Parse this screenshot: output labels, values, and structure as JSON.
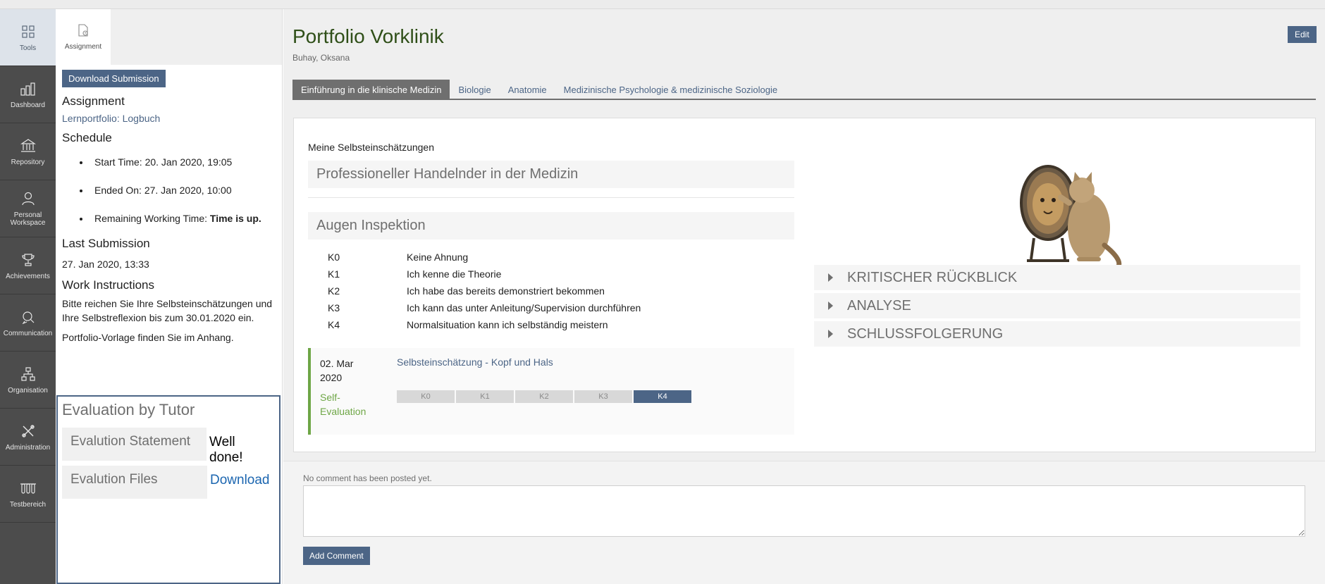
{
  "mainbar": {
    "items": [
      {
        "label": "Tools",
        "icon": "tools-icon"
      },
      {
        "label": "Dashboard",
        "icon": "dashboard-icon"
      },
      {
        "label": "Repository",
        "icon": "repository-icon"
      },
      {
        "label": "Personal Workspace",
        "icon": "person-icon"
      },
      {
        "label": "Achievements",
        "icon": "trophy-icon"
      },
      {
        "label": "Communication",
        "icon": "chat-icon"
      },
      {
        "label": "Organisation",
        "icon": "org-chart-icon"
      },
      {
        "label": "Administration",
        "icon": "wrench-icon"
      },
      {
        "label": "Testbereich",
        "icon": "test-tubes-icon"
      }
    ]
  },
  "slate": {
    "tab_label": "Assignment",
    "download_label": "Download Submission",
    "assignment_heading": "Assignment",
    "assignment_link": "Lernportfolio: Logbuch",
    "schedule_heading": "Schedule",
    "start_time": "Start Time: 20. Jan 2020, 19:05",
    "ended_on": "Ended On: 27. Jan 2020, 10:00",
    "remaining_prefix": "Remaining Working Time: ",
    "remaining_value": "Time is up.",
    "last_submission_heading": "Last Submission",
    "last_submission_value": "27. Jan 2020, 13:33",
    "instructions_heading": "Work Instructions",
    "instructions_text": "Bitte reichen Sie Ihre Selbsteinschätzungen und Ihre Selbstreflexion bis zum 30.01.2020 ein.",
    "instructions_text2": "Portfolio-Vorlage finden Sie im Anhang.",
    "evaluation": {
      "title": "Evaluation by Tutor",
      "statement_label": "Evalution Statement",
      "statement_value": "Well done!",
      "files_label": "Evalution Files",
      "files_value": "Download"
    }
  },
  "main": {
    "title": "Portfolio Vorklinik",
    "subtitle": "Buhay, Oksana",
    "edit_label": "Edit",
    "tabs": [
      {
        "label": "Einführung in die klinische Medizin",
        "active": true
      },
      {
        "label": "Biologie",
        "active": false
      },
      {
        "label": "Anatomie",
        "active": false
      },
      {
        "label": "Medizinische Psychologie & medizinische Soziologie",
        "active": false
      }
    ],
    "section_heading": "Meine Selbsteinschätzungen",
    "block1_title": "Professioneller Handelnder in der Medizin",
    "block2_title": "Augen Inspektion",
    "levels": [
      {
        "code": "K0",
        "text": "Keine Ahnung"
      },
      {
        "code": "K1",
        "text": "Ich kenne die Theorie"
      },
      {
        "code": "K2",
        "text": "Ich habe das bereits demonstriert bekommen"
      },
      {
        "code": "K3",
        "text": "Ich kann das unter Anleitung/Supervision durchführen"
      },
      {
        "code": "K4",
        "text": "Normalsituation kann ich selbständig meistern"
      }
    ],
    "entry": {
      "date": "02. Mar 2020",
      "link": "Selbsteinschätzung - Kopf und Hals",
      "label": "Self-Evaluation",
      "scale": [
        "K0",
        "K1",
        "K2",
        "K3",
        "K4"
      ],
      "selected": "K4"
    },
    "accordions": [
      "KRITISCHER RÜCKBLICK",
      "ANALYSE",
      "SCHLUSSFOLGERUNG"
    ],
    "comments": {
      "empty_text": "No comment has been posted yet.",
      "add_label": "Add Comment"
    }
  },
  "colors": {
    "mainbar_bg": "#4c4c4c",
    "accent": "#4c6586",
    "title_green": "#2f4f18",
    "self_eval_green": "#6ea646"
  }
}
